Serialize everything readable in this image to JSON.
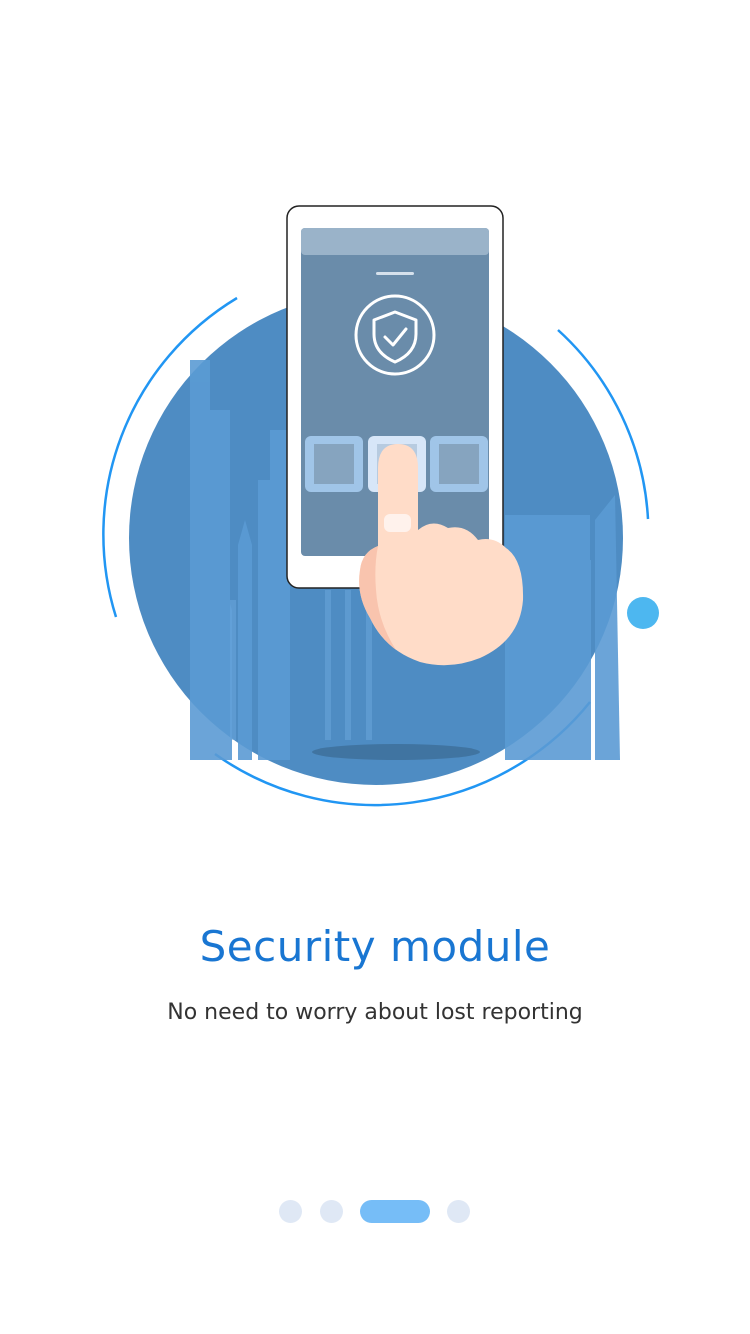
{
  "onboarding": {
    "title": "Security module",
    "subtitle": "No need to worry about lost reporting",
    "illustration": {
      "icons": [
        "city-skyline",
        "phone",
        "shield-check-icon",
        "pointing-hand-icon"
      ]
    },
    "pager": {
      "page_count": 4,
      "current_page": 3
    }
  },
  "colors": {
    "title": "#1976d2",
    "subtitle": "#333333",
    "circle": "#4e8cc3",
    "ring": "#2196f3",
    "accent_dot": "#4db7f0",
    "pager_active": "#76bdf7",
    "pager_inactive": "#dfe8f5",
    "screen": "#6a8caa"
  }
}
